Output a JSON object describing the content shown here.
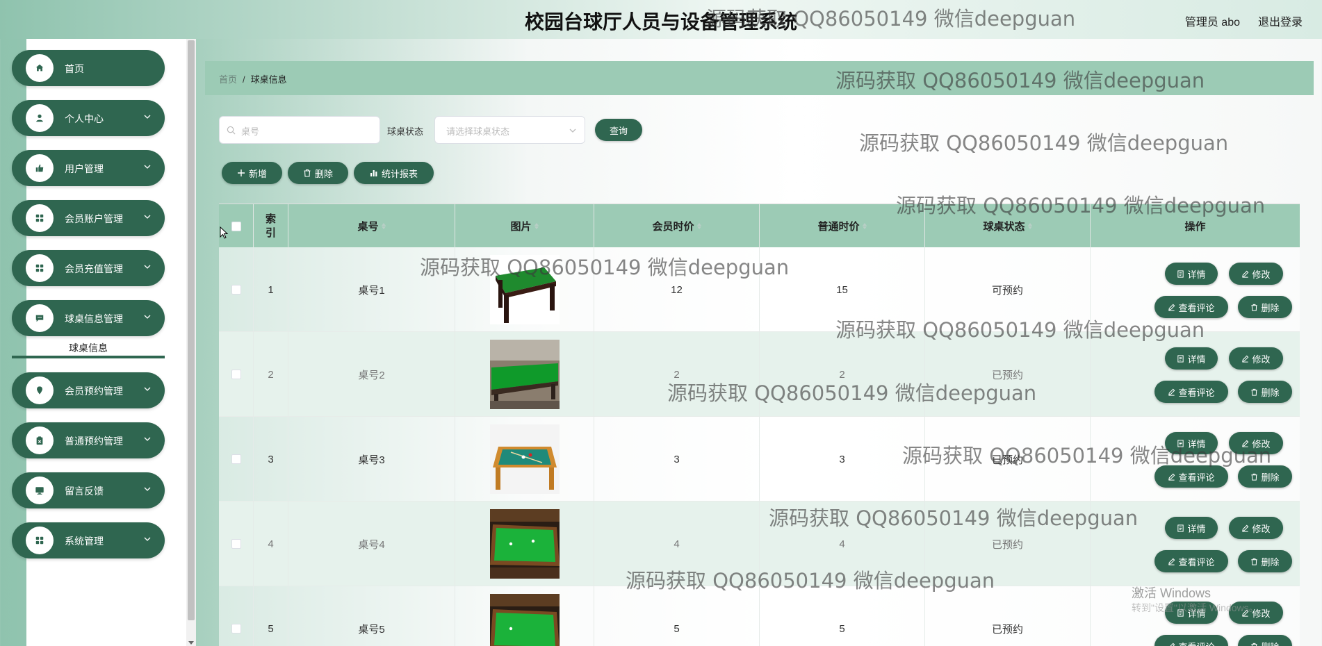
{
  "header": {
    "title": "校园台球厅人员与设备管理系统",
    "admin_label": "管理员 abo",
    "logout": "退出登录"
  },
  "sidebar": {
    "items": [
      {
        "label": "首页",
        "icon": "home-icon"
      },
      {
        "label": "个人中心",
        "icon": "user-icon"
      },
      {
        "label": "用户管理",
        "icon": "thumb-icon"
      },
      {
        "label": "会员账户管理",
        "icon": "grid-icon"
      },
      {
        "label": "会员充值管理",
        "icon": "grid-icon"
      },
      {
        "label": "球桌信息管理",
        "icon": "chat-icon"
      },
      {
        "label": "会员预约管理",
        "icon": "location-icon"
      },
      {
        "label": "普通预约管理",
        "icon": "clipboard-icon"
      },
      {
        "label": "留言反馈",
        "icon": "monitor-icon"
      },
      {
        "label": "系统管理",
        "icon": "grid-icon"
      }
    ],
    "active_sub": "球桌信息"
  },
  "breadcrumb": {
    "home": "首页",
    "sep": "/",
    "current": "球桌信息"
  },
  "search": {
    "table_placeholder": "桌号",
    "status_label": "球桌状态",
    "status_placeholder": "请选择球桌状态",
    "query": "查询"
  },
  "toolbar": {
    "add": "新增",
    "delete": "删除",
    "report": "统计报表"
  },
  "table": {
    "headers": [
      "索引",
      "桌号",
      "图片",
      "会员时价",
      "普通时价",
      "球桌状态",
      "操作"
    ],
    "rows": [
      {
        "index": "1",
        "table_no": "桌号1",
        "member_price": "12",
        "normal_price": "15",
        "status": "可预约"
      },
      {
        "index": "2",
        "table_no": "桌号2",
        "member_price": "2",
        "normal_price": "2",
        "status": "已预约"
      },
      {
        "index": "3",
        "table_no": "桌号3",
        "member_price": "3",
        "normal_price": "3",
        "status": "已预约"
      },
      {
        "index": "4",
        "table_no": "桌号4",
        "member_price": "4",
        "normal_price": "4",
        "status": "已预约"
      },
      {
        "index": "5",
        "table_no": "桌号5",
        "member_price": "5",
        "normal_price": "5",
        "status": "已预约"
      }
    ],
    "actions": {
      "detail": "详情",
      "edit": "修改",
      "comments": "查看评论",
      "remove": "删除"
    }
  },
  "watermark": "源码获取 QQ86050149 微信deepguan",
  "os_notice": {
    "line1": "激活 Windows",
    "line2": "转到\"设置\"以激活 Windows。"
  },
  "colors": {
    "primary": "#2f6650",
    "header_green": "#9ccbb5",
    "row_alt": "#e6f2ec"
  }
}
